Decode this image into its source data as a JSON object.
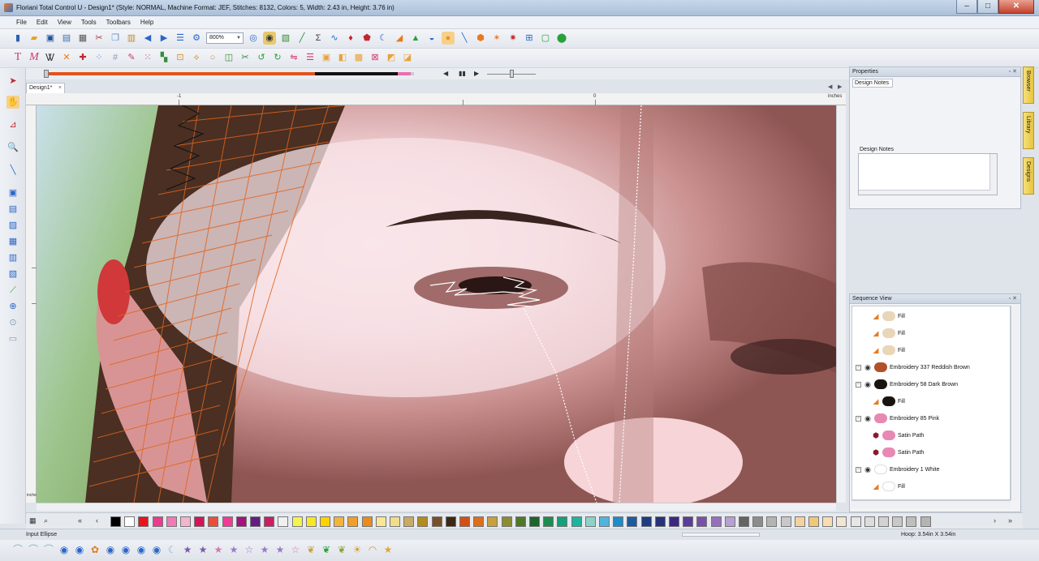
{
  "window": {
    "title": "Floriani Total Control U - Design1* (Style: NORMAL, Machine Format: JEF, Stitches: 8132, Colors: 5, Width: 2.43 in, Height: 3.76 in)",
    "minimize": "–",
    "maximize": "□",
    "close": "✕"
  },
  "menu": [
    "File",
    "Edit",
    "View",
    "Tools",
    "Toolbars",
    "Help"
  ],
  "toolbar": {
    "zoom_value": "800%"
  },
  "document": {
    "tab_label": "Design1*",
    "tab_close": "×"
  },
  "ruler": {
    "h_labels": [
      "-1",
      "0"
    ],
    "unit": "inches",
    "v_unit": "inches"
  },
  "properties": {
    "title": "Properties",
    "tab_label": "Design Notes",
    "group_label": "Design Notes",
    "notes_value": ""
  },
  "side_tabs": [
    "Browser",
    "Library",
    "Designs"
  ],
  "sequence": {
    "title": "Sequence View",
    "rows": [
      {
        "label": "Fill",
        "level": 2,
        "color": "#e9d6b8"
      },
      {
        "label": "Fill",
        "level": 2,
        "color": "#e9d6b8"
      },
      {
        "label": "Fill",
        "level": 2,
        "color": "#e9d6b8"
      },
      {
        "label": "Embroidery 337 Reddish Brown",
        "level": 1,
        "color": "#b2502a"
      },
      {
        "label": "Embroidery 58 Dark Brown",
        "level": 1,
        "color": "#1a1410"
      },
      {
        "label": "Fill",
        "level": 2,
        "color": "#1a1410"
      },
      {
        "label": "Embroidery 85 Pink",
        "level": 1,
        "color": "#e889b4"
      },
      {
        "label": "Satin Path",
        "level": 2,
        "color": "#e889b4"
      },
      {
        "label": "Satin Path",
        "level": 2,
        "color": "#e889b4"
      },
      {
        "label": "Embroidery 1 White",
        "level": 1,
        "color": "#ffffff"
      },
      {
        "label": "Fill",
        "level": 2,
        "color": "#ffffff"
      }
    ]
  },
  "status": {
    "text": "Input Ellipse",
    "hoop": "Hoop: 3.54in X 3.54in"
  },
  "playback": {
    "position": 0.0,
    "speed": 0.5
  },
  "palette": [
    "#000000",
    "#ffffff",
    "#e8141e",
    "#e83c8c",
    "#f07ab4",
    "#f4b4cc",
    "#d4145a",
    "#e8503c",
    "#f03c96",
    "#a0147c",
    "#641e82",
    "#c81e64",
    "#f0f0f0",
    "#f4f450",
    "#f8e628",
    "#fcd200",
    "#f4b43c",
    "#f0a028",
    "#e88c1e",
    "#fce696",
    "#f0dc8c",
    "#c8aa64",
    "#b48c1e",
    "#785028",
    "#3c2814",
    "#d25014",
    "#dc6e1e",
    "#c8a03c",
    "#8c8c32",
    "#507828",
    "#1e642d",
    "#1e8c50",
    "#14a078",
    "#1eb4a0",
    "#8cd2c8",
    "#50b4dc",
    "#1e8cc8",
    "#1e5aa0",
    "#1e3c82",
    "#283278",
    "#3c2882",
    "#5a3c96",
    "#7850aa",
    "#966ebe",
    "#b4a0d2",
    "#646464",
    "#8c8c8c",
    "#b4b4b4",
    "#c8c8c8",
    "#f4d2a0",
    "#f0c87a",
    "#fadcb4",
    "#f0e6d2",
    "#e6e6e6",
    "#dcdcdc",
    "#d2d2d2",
    "#c8c8c8",
    "#bebebe",
    "#b4b4b4"
  ]
}
